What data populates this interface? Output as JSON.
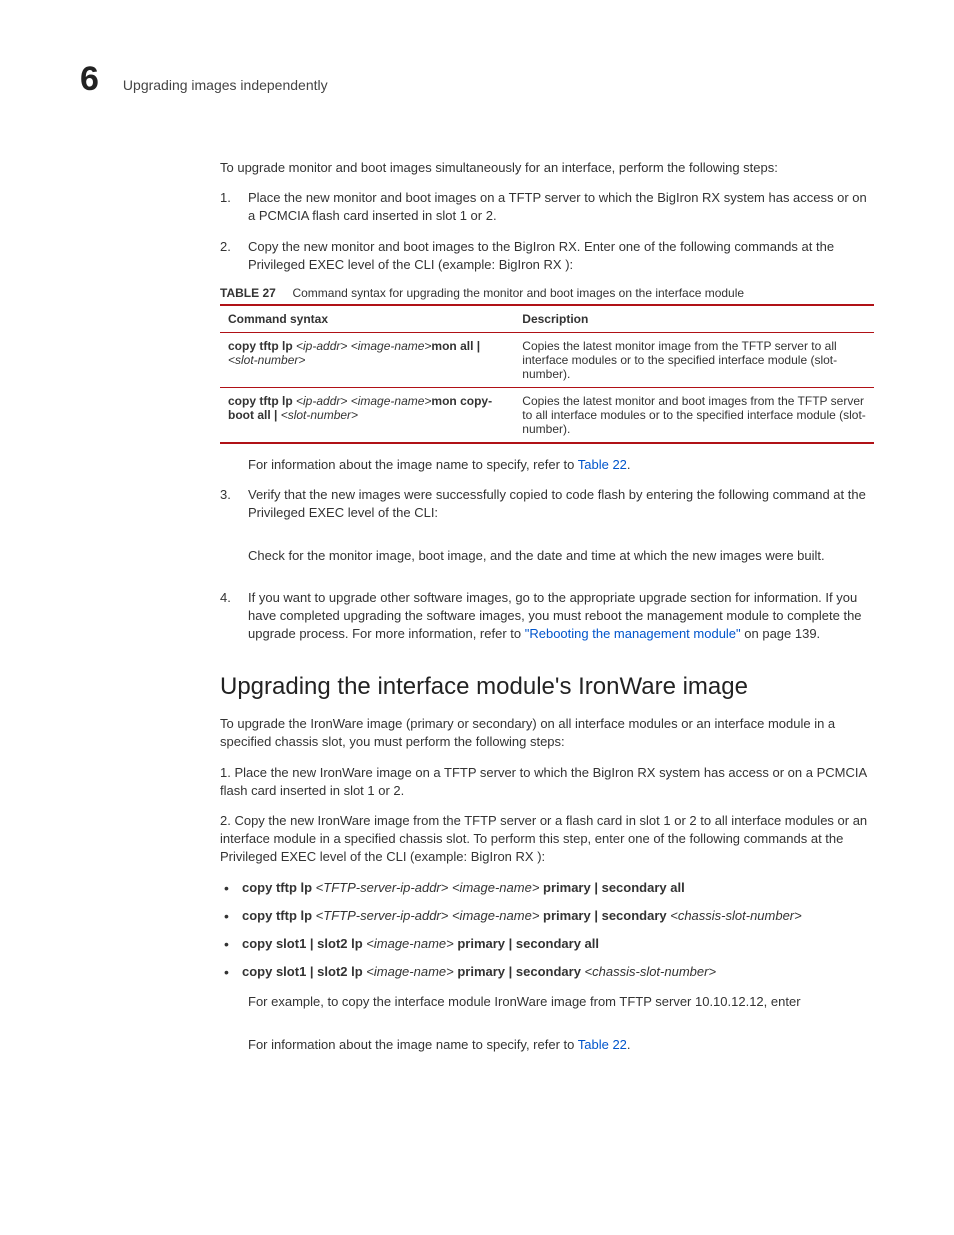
{
  "header": {
    "chapter_number": "6",
    "chapter_title": "Upgrading images independently"
  },
  "body": {
    "intro": "To upgrade monitor and boot images simultaneously for an interface, perform the following steps:",
    "step1_num": "1.",
    "step1": "Place the new monitor and boot images on a TFTP server to which the BigIron RX system has access or on a PCMCIA flash card inserted in slot 1 or 2.",
    "step2_num": "2.",
    "step2": "Copy the new monitor and boot images to the BigIron RX. Enter one of the following commands at the Privileged EXEC level of the CLI (example: BigIron RX  ):",
    "table": {
      "label": "TABLE 27",
      "caption": "Command syntax for upgrading the monitor and boot images on the interface module",
      "col1": "Command syntax",
      "col2": "Description",
      "r1_cmd_p1": "copy tftp lp ",
      "r1_cmd_p2": "<ip-addr> <image-name>",
      "r1_cmd_p3": "mon all | ",
      "r1_cmd_p4": "<slot-number>",
      "r1_desc": "Copies the latest monitor image from the TFTP server to all interface modules or to the specified interface module (slot-number).",
      "r2_cmd_p1": "copy tftp lp ",
      "r2_cmd_p2": "<ip-addr> <image-name>",
      "r2_cmd_p3": "mon copy-boot all | ",
      "r2_cmd_p4": "<slot-number>",
      "r2_desc": "Copies the latest monitor and boot images from the TFTP server to all interface modules or to the specified interface module (slot-number)."
    },
    "after_table_text": "For information about the image name to specify, refer to ",
    "after_table_link": "Table 22",
    "after_table_period": ".",
    "step3_num": "3.",
    "step3a": "Verify that the new images were successfully copied to code flash by entering the following command at the Privileged EXEC level of the CLI:",
    "step3b": "Check for the monitor image, boot image, and the date and time at which the new images were built.",
    "step4_num": "4.",
    "step4a": "If you want to upgrade other software images, go to the appropriate upgrade section for information. If you have completed upgrading the software images, you must reboot the management module to complete the upgrade process. For more information, refer to ",
    "step4_link": "\"Rebooting the management module\"",
    "step4b": " on page 139."
  },
  "section2": {
    "heading": "Upgrading the interface module's IronWare image",
    "p1": "To upgrade the IronWare image (primary or secondary) on all interface modules or an interface module in a specified chassis slot, you must perform the following steps:",
    "p2": "1.   Place the new IronWare image on a TFTP server to which the BigIron RX system has access or on a PCMCIA flash card inserted in slot 1 or 2.",
    "p3": "2.   Copy the new IronWare image from the TFTP server or a flash card in slot 1 or 2 to all interface modules or an interface module in a specified chassis slot. To perform this step, enter one of the following commands at the Privileged EXEC level of the CLI (example:  BigIron RX  ):",
    "b1_p1": "copy tftp lp ",
    "b1_p2": "<TFTP-server-ip-addr> <image-name>",
    "b1_p3": " primary | secondary all",
    "b2_p1": "copy tftp lp ",
    "b2_p2": "<TFTP-server-ip-addr> <image-name>",
    "b2_p3": " primary | secondary ",
    "b2_p4": "<chassis-slot-number>",
    "b3_p1": "copy slot1 | slot2 lp ",
    "b3_p2": "<image-name>",
    "b3_p3": " primary | secondary all",
    "b4_p1": "copy slot1 | slot2 lp ",
    "b4_p2": "<image-name>",
    "b4_p3": " primary | secondary ",
    "b4_p4": "<chassis-slot-number>",
    "example_line": "For example, to copy the interface module IronWare image from TFTP server 10.10.12.12, enter",
    "info_text": "For information about the image name to specify, refer to ",
    "info_link": "Table 22",
    "info_period": "."
  }
}
